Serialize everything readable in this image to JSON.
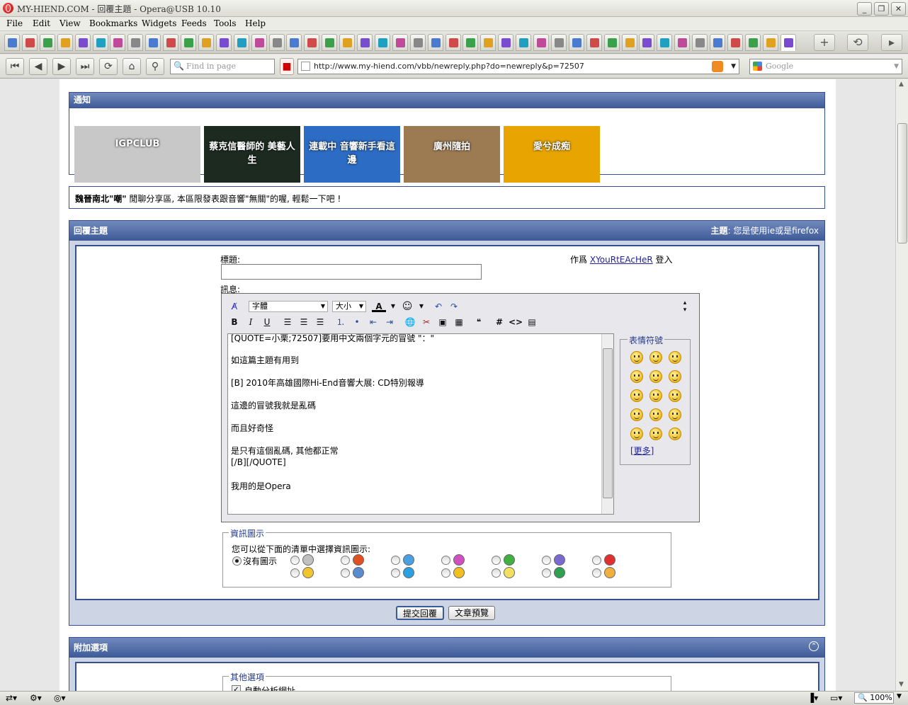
{
  "window": {
    "title": "MY-HIEND.COM - 回覆主題 - Opera@USB 10.10"
  },
  "menu": [
    "File",
    "Edit",
    "View",
    "Bookmarks",
    "Widgets",
    "Feeds",
    "Tools",
    "Help"
  ],
  "toolbar": {
    "find_placeholder": "Find in page",
    "url": "http://www.my-hiend.com/vbb/newreply.php?do=newreply&p=72507",
    "search_placeholder": "Google"
  },
  "notice": {
    "header": "通知",
    "banners": [
      {
        "text": "IGPCLUB",
        "bg": "#c8c8c8"
      },
      {
        "text": "蔡克信醫師的 美藝人生",
        "bg": "#1c2a20"
      },
      {
        "text": "連載中 音響新手看這邊",
        "bg": "#2c6cc4"
      },
      {
        "text": "廣州隨拍",
        "bg": "#9c7a52"
      },
      {
        "text": "愛兮成痴",
        "bg": "#e8a400"
      }
    ]
  },
  "forum_desc": {
    "title": "魏晉南北\"嘲\"",
    "text": "閒聊分享區, 本區限發表跟音響\"無關\"的喔, 輕鬆一下吧 !"
  },
  "reply": {
    "header": "回覆主題",
    "topic_label": "主題",
    "topic_value": ": 您是使用ie或是firefox",
    "subject_label": "標題:",
    "subject_value": "",
    "author_prefix": "作爲",
    "author_name": "XYouRtEAcHeR",
    "author_suffix": "登入",
    "message_label": "訊息:",
    "font_select": "字體",
    "size_select": "大小",
    "message_lines": [
      "[QUOTE=小栗;72507]要用中文兩個字元的冒號 \"：\"",
      "如這篇主題有用到",
      "[B] 2010年高雄國際Hi-End音響大展: CD特別報導",
      "這邊的冒號我就是亂碼",
      "而且好奇怪",
      "是只有這個亂碼, 其他都正常",
      "[/B][/QUOTE]",
      "我用的是Opera"
    ],
    "smilies_legend": "表情符號",
    "smilies_more": "[更多]",
    "icons_legend": "資訊圖示",
    "icons_text": "您可以從下面的清單中選擇資訊圖示:",
    "no_icon_label": "沒有圖示",
    "submit_label": "提交回覆",
    "preview_label": "文章預覽"
  },
  "extra": {
    "header": "附加選項",
    "other_legend": "其他選項",
    "auto_parse": "自動分析網址"
  },
  "status": {
    "zoom": "100%"
  }
}
